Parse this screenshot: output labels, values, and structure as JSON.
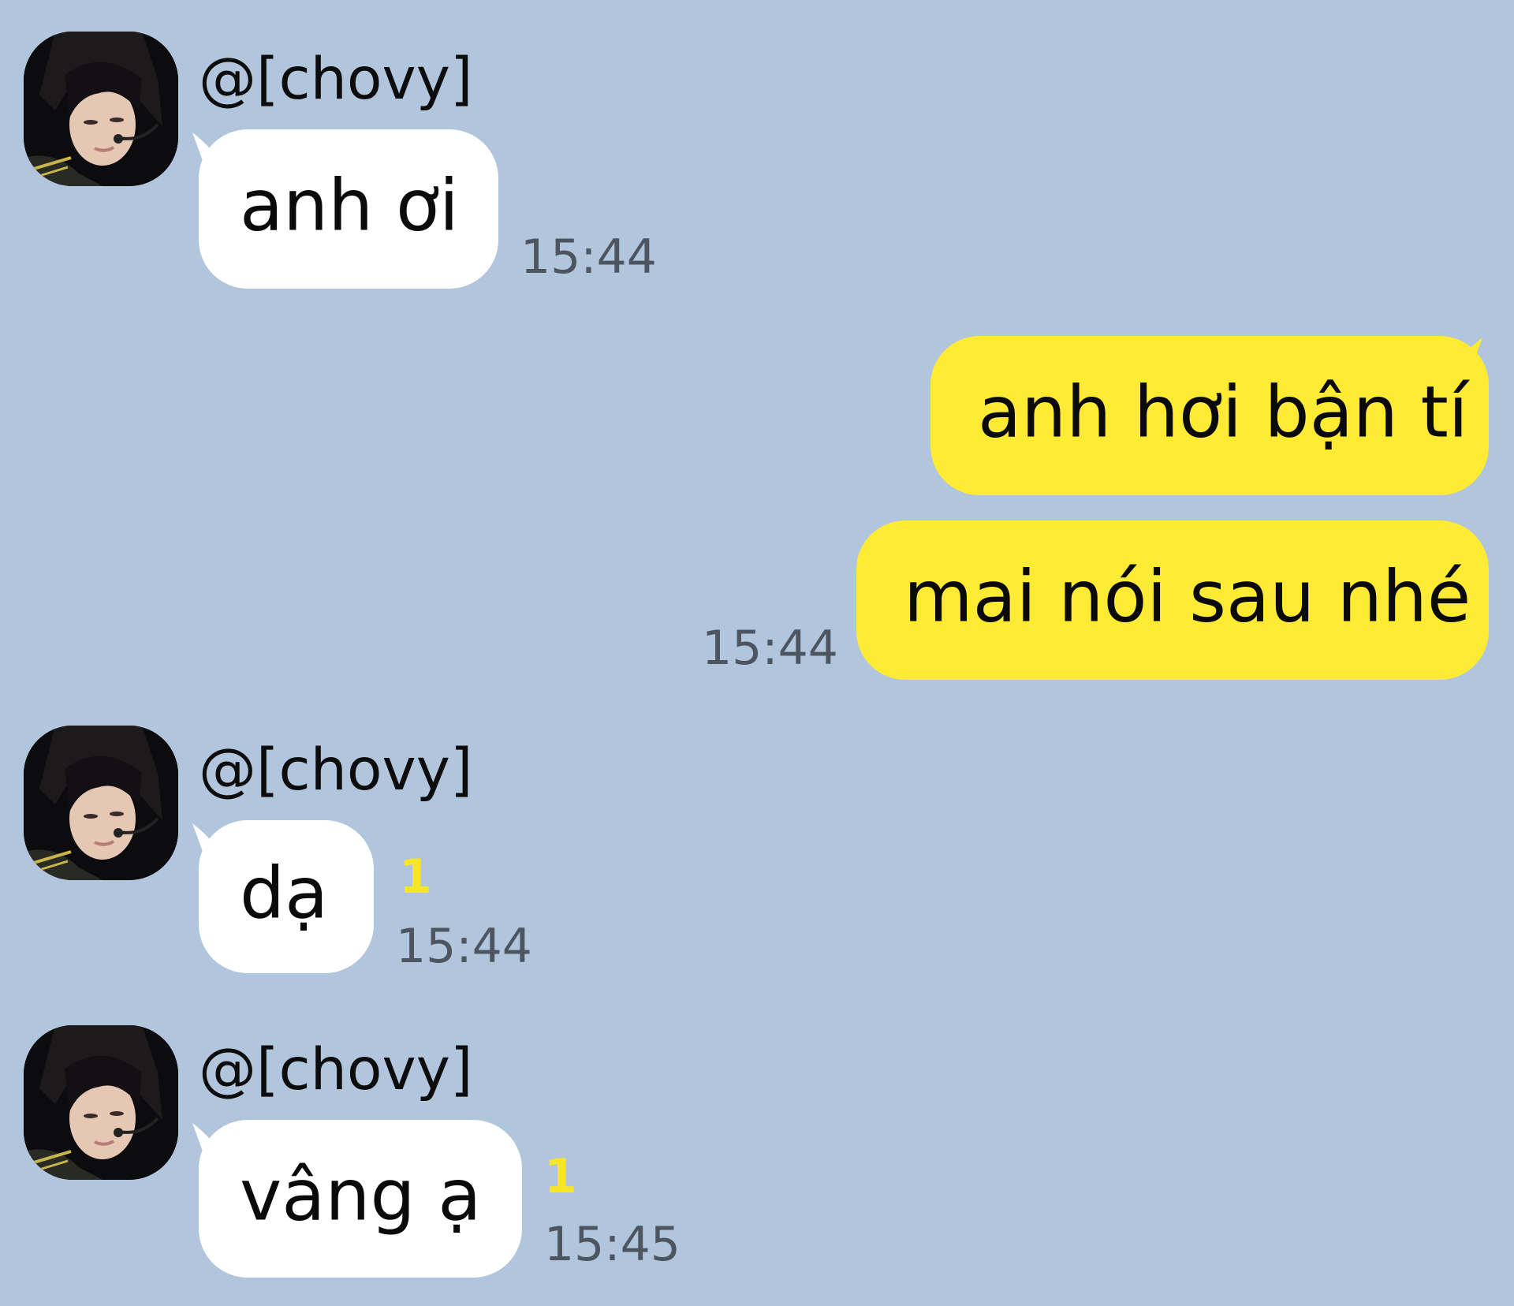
{
  "chat": {
    "sender_name": "@[chovy]",
    "messages": [
      {
        "text": "anh ơi",
        "time": "15:44"
      },
      {
        "text": "anh hơi bận tí"
      },
      {
        "text": "mai nói sau nhé",
        "time": "15:44"
      },
      {
        "text": "dạ",
        "time": "15:44",
        "unread": "1"
      },
      {
        "text": "vâng ạ",
        "time": "15:45",
        "unread": "1"
      }
    ]
  },
  "colors": {
    "background": "#b1c6dc",
    "incoming_bubble": "#ffffff",
    "outgoing_bubble": "#ffeb33",
    "unread_count": "#f7e528",
    "timestamp": "#4d5660"
  }
}
